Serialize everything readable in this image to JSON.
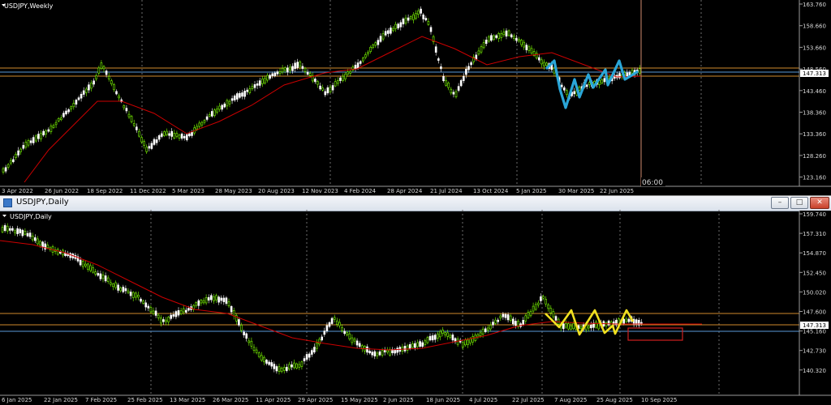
{
  "weekly": {
    "symbol_label": "USDJPY,Weekly",
    "price_labels": [
      "163.760",
      "158.660",
      "153.660",
      "148.560",
      "143.460",
      "138.360",
      "133.360",
      "128.260",
      "123.160"
    ],
    "current_price": "147.313",
    "date_labels": [
      "3 Apr 2022",
      "26 Jun 2022",
      "18 Sep 2022",
      "11 Dec 2022",
      "5 Mar 2023",
      "28 May 2023",
      "20 Aug 2023",
      "12 Nov 2023",
      "4 Feb 2024",
      "28 Apr 2024",
      "21 Jul 2024",
      "13 Oct 2024",
      "5 Jan 2025",
      "30 Mar 2025",
      "22 Jun 2025"
    ],
    "cursor_time": "06:00"
  },
  "daily": {
    "window_title": "USDJPY,Daily",
    "symbol_label": "USDJPY,Daily",
    "price_labels": [
      "159.740",
      "157.310",
      "154.870",
      "152.450",
      "150.020",
      "147.600",
      "145.160",
      "142.730",
      "140.320"
    ],
    "current_price": "147.313",
    "date_labels": [
      "6 Jan 2025",
      "22 Jan 2025",
      "7 Feb 2025",
      "25 Feb 2025",
      "13 Mar 2025",
      "26 Mar 2025",
      "11 Apr 2025",
      "29 Apr 2025",
      "15 May 2025",
      "2 Jun 2025",
      "18 Jun 2025",
      "4 Jul 2025",
      "22 Jul 2025",
      "7 Aug 2025",
      "25 Aug 2025",
      "10 Sep 2025"
    ],
    "controls": {
      "minimize": "–",
      "maximize": "□",
      "close": "✕"
    }
  },
  "colors": {
    "bull_candle": "#7CFC00",
    "bear_candle": "#ffffff",
    "moving_average": "#cc0000",
    "grid": "#6e6e6e",
    "weekly_drawing": "#2aa6d8",
    "daily_drawing": "#f0e020",
    "orange_level": "#d08a2c",
    "blue_level": "#5a9ad8",
    "target_box": "#d02020"
  }
}
